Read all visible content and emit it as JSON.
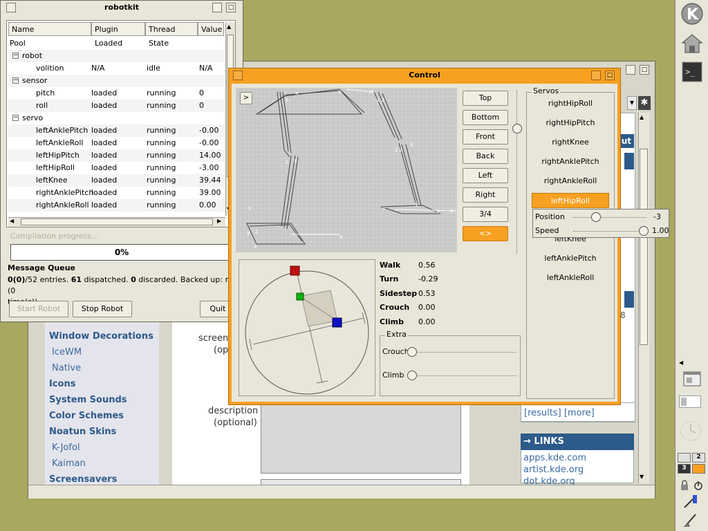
{
  "colors": {
    "desktop": "#a8a860",
    "orange": "#f7a021",
    "kde_blue": "#2c5a8a"
  },
  "robotkit": {
    "title": "robotkit",
    "columns": [
      "Name",
      "Plugin Loaded",
      "Thread State",
      "Value"
    ],
    "rows": [
      {
        "name": "Pool",
        "plugin": "",
        "thread": "",
        "value": ""
      },
      {
        "name": "robot",
        "plugin": "",
        "thread": "",
        "value": ""
      },
      {
        "name": "volition",
        "plugin": "N/A",
        "thread": "idle",
        "value": "N/A"
      },
      {
        "name": "sensor",
        "plugin": "",
        "thread": "",
        "value": ""
      },
      {
        "name": "pitch",
        "plugin": "loaded",
        "thread": "running",
        "value": "0"
      },
      {
        "name": "roll",
        "plugin": "loaded",
        "thread": "running",
        "value": "0"
      },
      {
        "name": "servo",
        "plugin": "",
        "thread": "",
        "value": ""
      },
      {
        "name": "leftAnklePitch",
        "plugin": "loaded",
        "thread": "running",
        "value": "-0.00"
      },
      {
        "name": "leftAnkleRoll",
        "plugin": "loaded",
        "thread": "running",
        "value": "-0.00"
      },
      {
        "name": "leftHipPitch",
        "plugin": "loaded",
        "thread": "running",
        "value": "14.00"
      },
      {
        "name": "leftHipRoll",
        "plugin": "loaded",
        "thread": "running",
        "value": "-3.00"
      },
      {
        "name": "leftKnee",
        "plugin": "loaded",
        "thread": "running",
        "value": "39.44"
      },
      {
        "name": "rightAnklePitch",
        "plugin": "loaded",
        "thread": "running",
        "value": "39.00"
      },
      {
        "name": "rightAnkleRoll",
        "plugin": "loaded",
        "thread": "running",
        "value": "0.00"
      }
    ],
    "compilation_label": "Compilation progress...",
    "progress": "0%",
    "mq_title": "Message Queue",
    "mq_a": "0(0)",
    "mq_b": "/52 entries. ",
    "mq_c": "61",
    "mq_d": " dispatched. ",
    "mq_e": "0",
    "mq_f": " discarded. Backed up: no (0",
    "mq_g": "time(s))",
    "start_robot": "Start Robot",
    "stop_robot": "Stop Robot",
    "quit": "Quit"
  },
  "control": {
    "title": "Control",
    "view_toggle": ">",
    "view_buttons": [
      "Top",
      "Bottom",
      "Front",
      "Back",
      "Left",
      "Right",
      "3/4",
      "<>"
    ],
    "params": [
      {
        "label": "Walk",
        "value": "0.56"
      },
      {
        "label": "Turn",
        "value": "-0.29"
      },
      {
        "label": "Sidestep",
        "value": "0.53"
      },
      {
        "label": "Crouch",
        "value": "0.00"
      },
      {
        "label": "Climb",
        "value": "0.00"
      }
    ],
    "extra_title": "Extra",
    "extra_crouch": "Crouch",
    "extra_climb": "Climb",
    "servos_title": "Servos",
    "servos_top": [
      "rightHipRoll",
      "rightHipPitch",
      "rightKnee",
      "rightAnklePitch",
      "rightAnkleRoll"
    ],
    "servo_selected": "leftHipRoll",
    "servos_bottom": [
      "leftKnee",
      "leftAnklePitch",
      "leftAnkleRoll"
    ],
    "popup_position_label": "Position",
    "popup_position_value": "-3",
    "popup_speed_label": "Speed",
    "popup_speed_value": "1.00"
  },
  "browser": {
    "nav_items": [
      {
        "label": "Window Decorations",
        "sub": false
      },
      {
        "label": "IceWM",
        "sub": true
      },
      {
        "label": "Native",
        "sub": true
      },
      {
        "label": "Icons",
        "sub": false
      },
      {
        "label": "System Sounds",
        "sub": false
      },
      {
        "label": "Color Schemes",
        "sub": false
      },
      {
        "label": "Noatun Skins",
        "sub": false
      },
      {
        "label": "K-Jofol",
        "sub": true
      },
      {
        "label": "Kaiman",
        "sub": true
      },
      {
        "label": "Screensavers",
        "sub": false
      }
    ],
    "form_screen": "screen",
    "form_opt1": "(opt",
    "form_description": "description",
    "form_opt2": "(optional)",
    "results_link": "[results] [more]",
    "links_header": "→ LINKS",
    "links": [
      "apps.kde.com",
      "artist.kde.org",
      "dot.kde.org"
    ],
    "button_fragment": "ut",
    "side_number": "8"
  },
  "taskbar": {
    "desktops": [
      "1",
      "2",
      "3",
      "4"
    ]
  }
}
